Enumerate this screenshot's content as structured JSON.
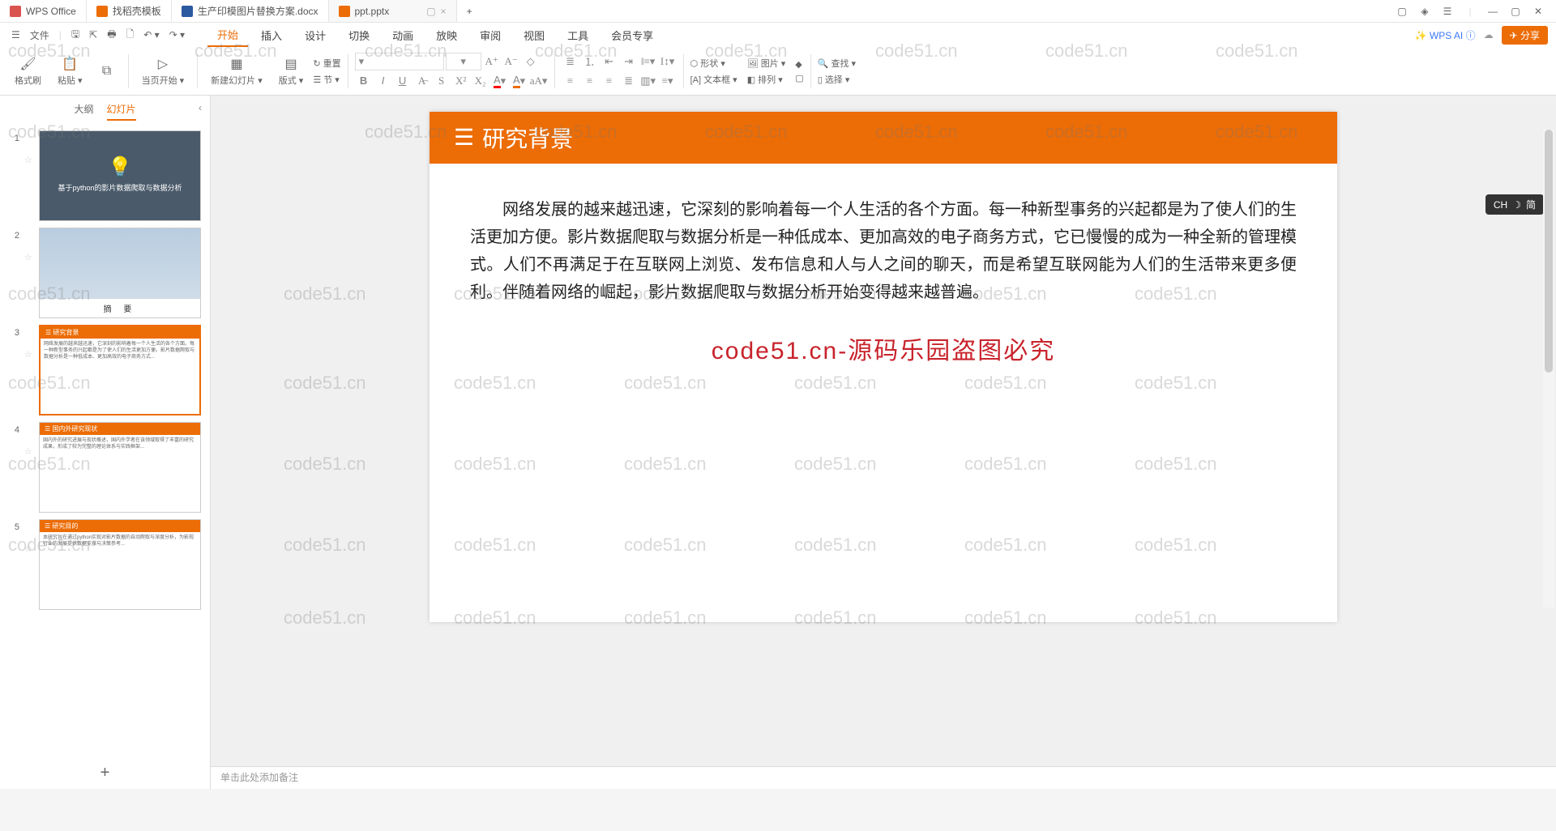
{
  "titlebar": {
    "app": "WPS Office",
    "tabs": [
      {
        "label": "找稻壳模板"
      },
      {
        "label": "生产印模图片替换方案.docx"
      },
      {
        "label": "ppt.pptx",
        "active": true
      }
    ],
    "add": "+"
  },
  "file_row": {
    "menu": "文件"
  },
  "menu": {
    "items": [
      "开始",
      "插入",
      "设计",
      "切换",
      "动画",
      "放映",
      "审阅",
      "视图",
      "工具",
      "会员专享"
    ],
    "active": "开始",
    "ai": "WPS AI",
    "share": "分享"
  },
  "ribbon": {
    "format_painter": "格式刷",
    "paste": "粘贴",
    "from_start": "当页开始",
    "new_slide": "新建幻灯片",
    "layout": "版式",
    "reset": "重置",
    "section": "节",
    "shape": "形状",
    "image": "图片",
    "textbox": "文本框",
    "arrange": "排列",
    "find": "查找",
    "select": "选择"
  },
  "panel": {
    "tab_outline": "大纲",
    "tab_slides": "幻灯片",
    "slides": [
      {
        "num": "1",
        "title": "基于python的影片数据爬取与数据分析"
      },
      {
        "num": "2",
        "caption": "摘 要"
      },
      {
        "num": "3",
        "title": "研究背景"
      },
      {
        "num": "4",
        "title": "国内外研究现状"
      },
      {
        "num": "5",
        "title": "研究目的"
      }
    ]
  },
  "slide": {
    "title": "研究背景",
    "body": "网络发展的越来越迅速，它深刻的影响着每一个人生活的各个方面。每一种新型事务的兴起都是为了使人们的生活更加方便。影片数据爬取与数据分析是一种低成本、更加高效的电子商务方式，它已慢慢的成为一种全新的管理模式。人们不再满足于在互联网上浏览、发布信息和人与人之间的聊天，而是希望互联网能为人们的生活带来更多便利。伴随着网络的崛起，影片数据爬取与数据分析开始变得越来越普遍。",
    "watermark": "code51.cn-源码乐园盗图必究"
  },
  "notes": {
    "placeholder": "单击此处添加备注"
  },
  "ime": {
    "label": "CH",
    "mode": "简"
  },
  "wm": "code51.cn"
}
